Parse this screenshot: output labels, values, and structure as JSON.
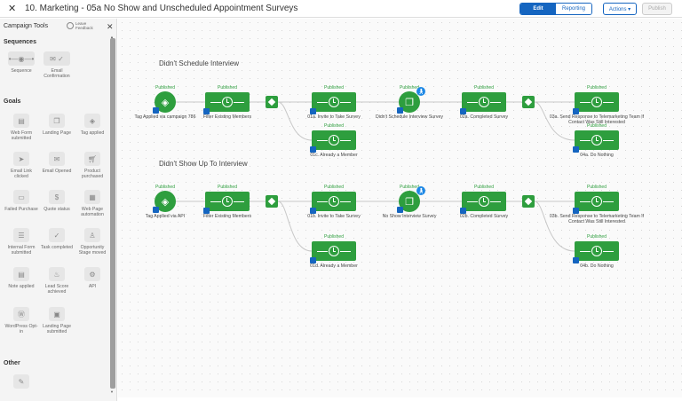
{
  "header": {
    "title": "10. Marketing - 05a No Show and Unscheduled Appointment Surveys",
    "close_label": "✕",
    "edit_label": "Edit",
    "reporting_label": "Reporting",
    "actions_label": "Actions ▾",
    "publish_label": "Publish"
  },
  "sidebar": {
    "title": "Campaign Tools",
    "feedback_label": "Leave Feedback",
    "close_label": "✕",
    "sections": {
      "sequences": "Sequences",
      "goals": "Goals",
      "other": "Other"
    },
    "sequence_tools": [
      {
        "label": "Sequence",
        "icon": "sequence-icon"
      },
      {
        "label": "Email Confirmation",
        "icon": "email-confirmation-icon"
      }
    ],
    "goal_tools": [
      {
        "label": "Web Form submitted",
        "icon": "web-form-icon"
      },
      {
        "label": "Landing Page",
        "icon": "landing-page-icon"
      },
      {
        "label": "Tag applied",
        "icon": "tag-icon"
      },
      {
        "label": "Email Link clicked",
        "icon": "cursor-icon"
      },
      {
        "label": "Email Opened",
        "icon": "envelope-open-icon"
      },
      {
        "label": "Product purchased",
        "icon": "cart-icon"
      },
      {
        "label": "Failed Purchase",
        "icon": "failed-purchase-icon"
      },
      {
        "label": "Quote status",
        "icon": "dollar-icon"
      },
      {
        "label": "Web Page automation",
        "icon": "web-page-icon"
      },
      {
        "label": "Internal Form submitted",
        "icon": "internal-form-icon"
      },
      {
        "label": "Task completed",
        "icon": "check-circle-icon"
      },
      {
        "label": "Opportunity Stage moved",
        "icon": "opportunity-icon"
      },
      {
        "label": "Note applied",
        "icon": "note-icon"
      },
      {
        "label": "Lead Score achieved",
        "icon": "flame-icon"
      },
      {
        "label": "API",
        "icon": "api-icon"
      },
      {
        "label": "WordPress Opt-in",
        "icon": "wordpress-icon"
      },
      {
        "label": "Landing Page submitted",
        "icon": "landing-page-submitted-icon"
      }
    ],
    "other_tools": [
      {
        "label": "",
        "icon": "pencil-icon"
      }
    ]
  },
  "canvas": {
    "published_label": "Published",
    "flows": [
      {
        "title": "Didn't Schedule Interview",
        "trigger": "Tag Applied via campaign 786",
        "filter": "Filter Existing Members",
        "invite": "01a. Invite to Take Survey",
        "already": "01c. Already a Member",
        "survey": "Didn't Schedule Interview Survey",
        "completed": "02a. Completed Survey",
        "send": "03a. Send Response to Telemarketing Team If Contact Was Still Interested",
        "nothing": "04a. Do Nothing"
      },
      {
        "title": "Didn't Show Up To Interview",
        "trigger": "Tag Applied via API",
        "filter": "Filter Existing Members",
        "invite": "01b. Invite to Take Survey",
        "already": "01d. Already a Member",
        "survey": "No Show Interview Survey",
        "completed": "02b. Completed Survey",
        "send": "03b. Send Response to Telemarketing Team If Contact Was Still Interested",
        "nothing": "04b. Do Nothing"
      }
    ]
  },
  "colors": {
    "accent": "#1565c0",
    "node_green": "#2e9e3e"
  }
}
